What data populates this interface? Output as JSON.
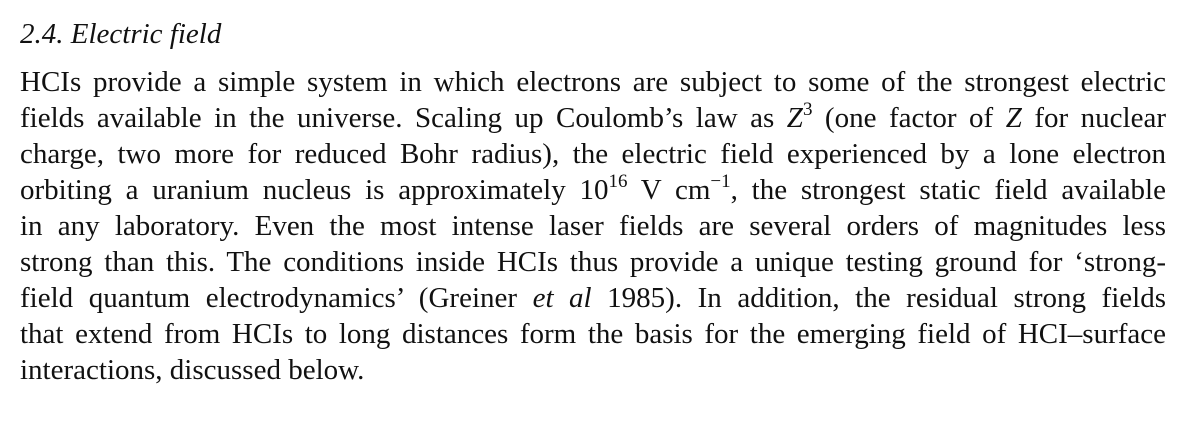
{
  "section": {
    "number": "2.4.",
    "title": "Electric field"
  },
  "paragraph": {
    "l1": "HCIs provide a simple system in which electrons are subject to some of the strongest electric",
    "l2_a": "fields available in the universe. Scaling up Coulomb’s law as ",
    "l2_var": "Z",
    "l2_exp": "3",
    "l2_b": " (one factor of ",
    "l2_var2": "Z",
    "l2_c": " for nuclear",
    "l3": "charge, two more for reduced Bohr radius), the electric field experienced by a lone electron",
    "l4_a": "orbiting a uranium nucleus is approximately 10",
    "l4_exp": "16",
    "l4_b": " V cm",
    "l4_exp2": "−1",
    "l4_c": ", the strongest static field available",
    "l5": "in any laboratory.  Even the most intense laser fields are several orders of magnitudes less",
    "l6": "strong than this. The conditions inside HCIs thus provide a unique testing ground for ‘strong-",
    "l7_a": "field quantum electrodynamics’ (Greiner ",
    "l7_it": "et al",
    "l7_b": " 1985).  In addition, the residual strong fields",
    "l8": "that extend from HCIs to long distances form the basis for the emerging field of HCI–surface",
    "l9": "interactions, discussed below."
  }
}
